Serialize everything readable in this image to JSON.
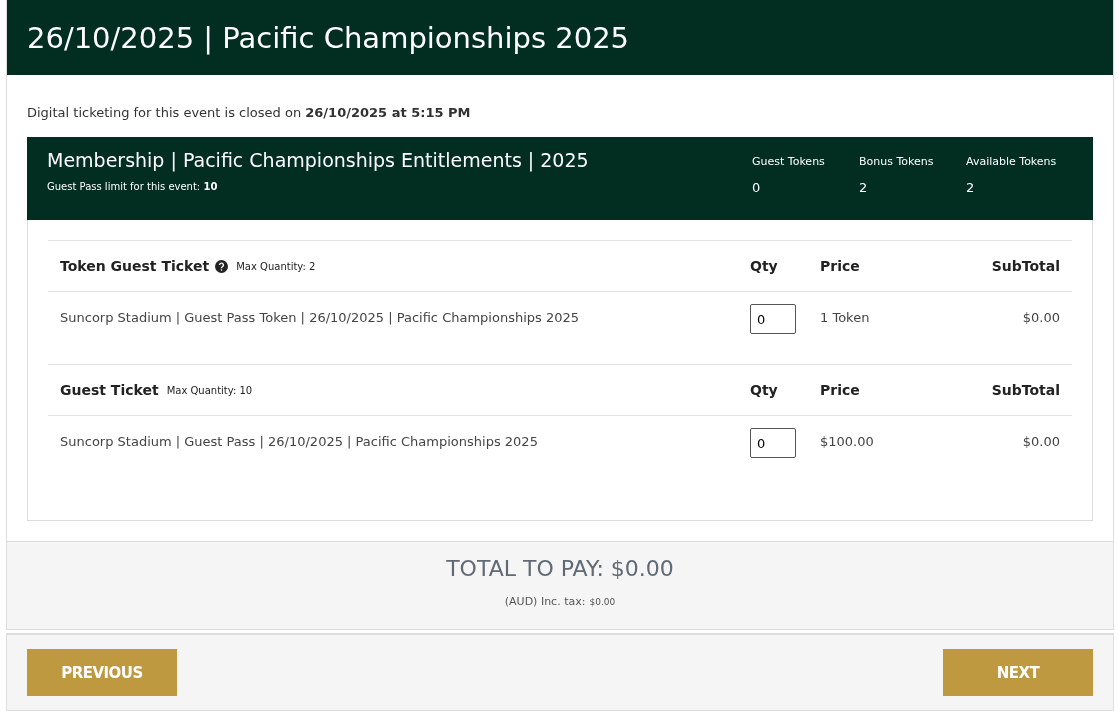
{
  "header": {
    "title": "26/10/2025 | Pacific Championships 2025"
  },
  "notice": "Digital ticketing for this event is closed on **26/10/2025 at 5:15 PM**",
  "membership": {
    "title": "Membership | Pacific Championships Entitlements | 2025",
    "limit": "Guest Pass limit for this event: **10**",
    "tokens": [
      {
        "label": "Guest Tokens",
        "value": "0"
      },
      {
        "label": "Bonus Tokens",
        "value": "2"
      },
      {
        "label": "Available Tokens",
        "value": "2"
      }
    ]
  },
  "sections": [
    {
      "title": "Token Guest Ticket",
      "help": true,
      "max": "Max Quantity: 2",
      "qty_header": "Qty",
      "price_header": "Price",
      "subtotal_header": "SubTotal",
      "description": "Suncorp Stadium | Guest Pass Token | 26/10/2025 | Pacific Championships 2025",
      "qty": "0",
      "price": "1 Token",
      "subtotal": "$0.00"
    },
    {
      "title": "Guest Ticket",
      "help": false,
      "max": "Max Quantity: 10",
      "qty_header": "Qty",
      "price_header": "Price",
      "subtotal_header": "SubTotal",
      "description": "Suncorp Stadium | Guest Pass | 26/10/2025 | Pacific Championships 2025",
      "qty": "0",
      "price": "$100.00",
      "subtotal": "$0.00"
    }
  ],
  "total": {
    "label": "TOTAL TO PAY: $0.00",
    "tax_label": "(AUD) Inc. tax:",
    "tax_value": "$0.00"
  },
  "buttons": [
    {
      "label": "PREVIOUS"
    },
    {
      "label": "NEXT"
    }
  ]
}
